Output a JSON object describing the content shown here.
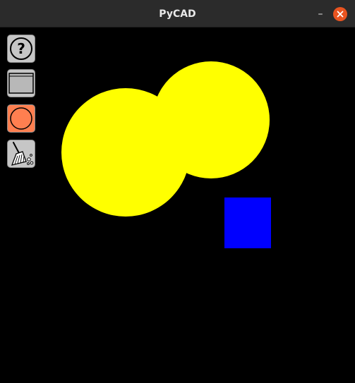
{
  "window": {
    "title": "PyCAD",
    "minimize_glyph": "–"
  },
  "toolbar": {
    "tools": [
      {
        "name": "help",
        "icon": "question-mark-icon",
        "help_glyph": "?"
      },
      {
        "name": "rectangle",
        "icon": "rectangle-icon"
      },
      {
        "name": "circle",
        "icon": "circle-icon",
        "selected": true,
        "highlight_color": "#ff7f50"
      },
      {
        "name": "clear",
        "icon": "broom-icon"
      }
    ]
  },
  "colors": {
    "canvas_background": "#000000",
    "circle_fill": "#ffff00",
    "rectangle_fill": "#0000ff",
    "close_button": "#e95420"
  }
}
